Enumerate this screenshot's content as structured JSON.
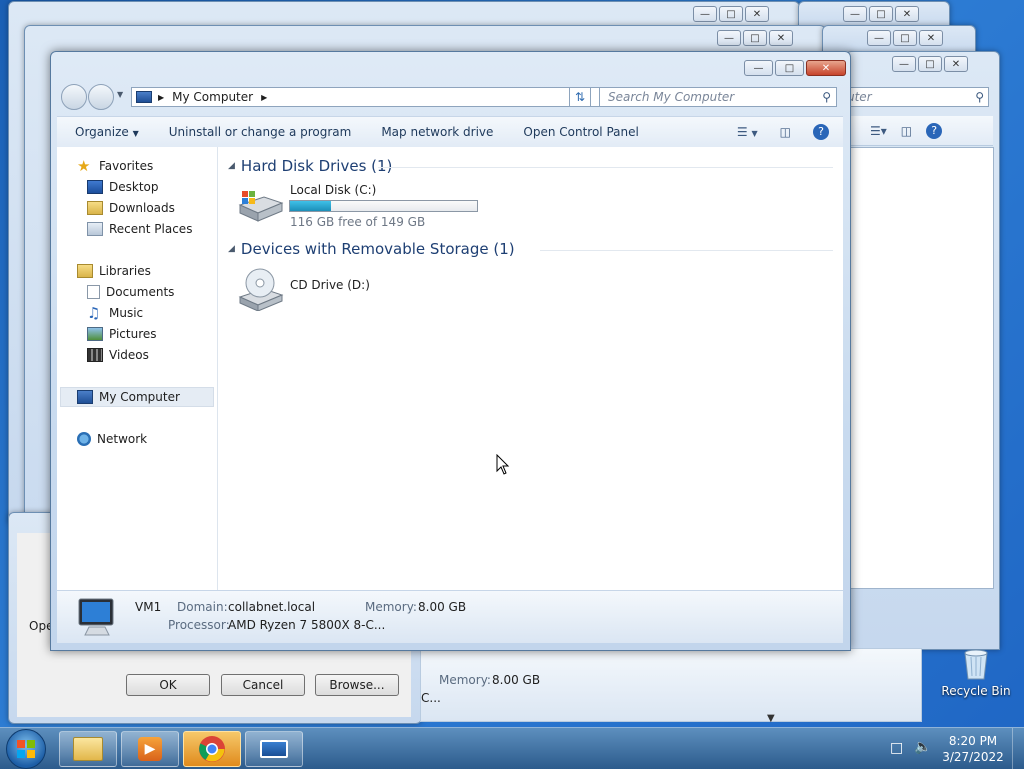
{
  "main_window": {
    "address": "My Computer",
    "search_placeholder": "Search My Computer",
    "toolbar": {
      "organize": "Organize",
      "uninstall": "Uninstall or change a program",
      "map_drive": "Map network drive",
      "control_panel": "Open Control Panel"
    },
    "nav": {
      "favorites": "Favorites",
      "desktop": "Desktop",
      "downloads": "Downloads",
      "recent": "Recent Places",
      "libraries": "Libraries",
      "documents": "Documents",
      "music": "Music",
      "pictures": "Pictures",
      "videos": "Videos",
      "computer": "My Computer",
      "network": "Network"
    },
    "groups": {
      "hdd_title": "Hard Disk Drives (1)",
      "removable_title": "Devices with Removable Storage (1)"
    },
    "drives": {
      "c_name": "Local Disk (C:)",
      "c_space": "116 GB free of 149 GB",
      "c_used_fraction": 0.22,
      "d_name": "CD Drive (D:)"
    },
    "details": {
      "name": "VM1",
      "domain_label": "Domain:",
      "domain": "collabnet.local",
      "memory_label": "Memory:",
      "memory": "8.00 GB",
      "processor_label": "Processor:",
      "processor": "AMD Ryzen 7 5800X 8-C..."
    }
  },
  "background": {
    "search_tail": "uter",
    "memory_label": "Memory:",
    "memory": "8.00 GB",
    "tail_c": "C...",
    "left_tail": "Ope",
    "dialog_ok": "OK",
    "dialog_cancel": "Cancel",
    "dialog_browse": "Browse..."
  },
  "desktop": {
    "recycle_bin": "Recycle Bin"
  },
  "taskbar": {
    "time": "8:20 PM",
    "date": "3/27/2022"
  }
}
